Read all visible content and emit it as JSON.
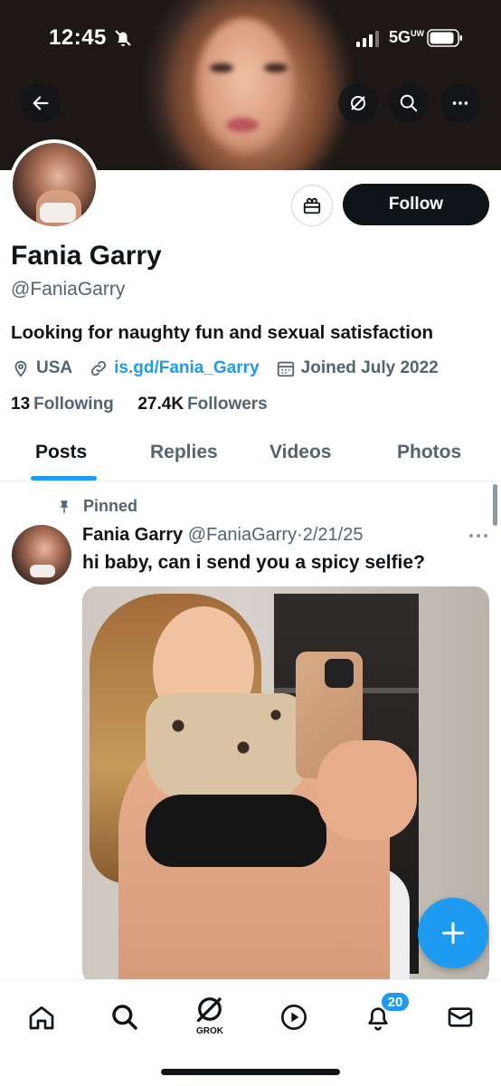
{
  "status_bar": {
    "time": "12:45",
    "network": "5G",
    "network_sub": "UW"
  },
  "profile": {
    "name": "Fania Garry",
    "handle": "@FaniaGarry",
    "bio": "Looking for naughty fun and sexual satisfaction",
    "location": "USA",
    "website": "is.gd/Fania_Garry",
    "joined": "Joined July 2022",
    "following_count": "13",
    "following_label": "Following",
    "followers_count": "27.4K",
    "followers_label": "Followers",
    "follow_button": "Follow"
  },
  "tabs": [
    {
      "label": "Posts",
      "active": true
    },
    {
      "label": "Replies",
      "active": false
    },
    {
      "label": "Videos",
      "active": false
    },
    {
      "label": "Photos",
      "active": false
    }
  ],
  "post": {
    "pinned_label": "Pinned",
    "author_name": "Fania Garry",
    "author_handle": "@FaniaGarry",
    "separator": "·",
    "date": "2/21/25",
    "text": "hi baby, can i send you a spicy selfie?"
  },
  "bottom_nav": {
    "items": [
      "home-icon",
      "search-icon",
      "grok-icon",
      "video-icon",
      "notifications-icon",
      "messages-icon"
    ],
    "grok_label": "GROK",
    "notifications_badge": "20"
  },
  "colors": {
    "accent": "#1d9bf0",
    "text": "#0f1419",
    "secondary": "#536471"
  }
}
